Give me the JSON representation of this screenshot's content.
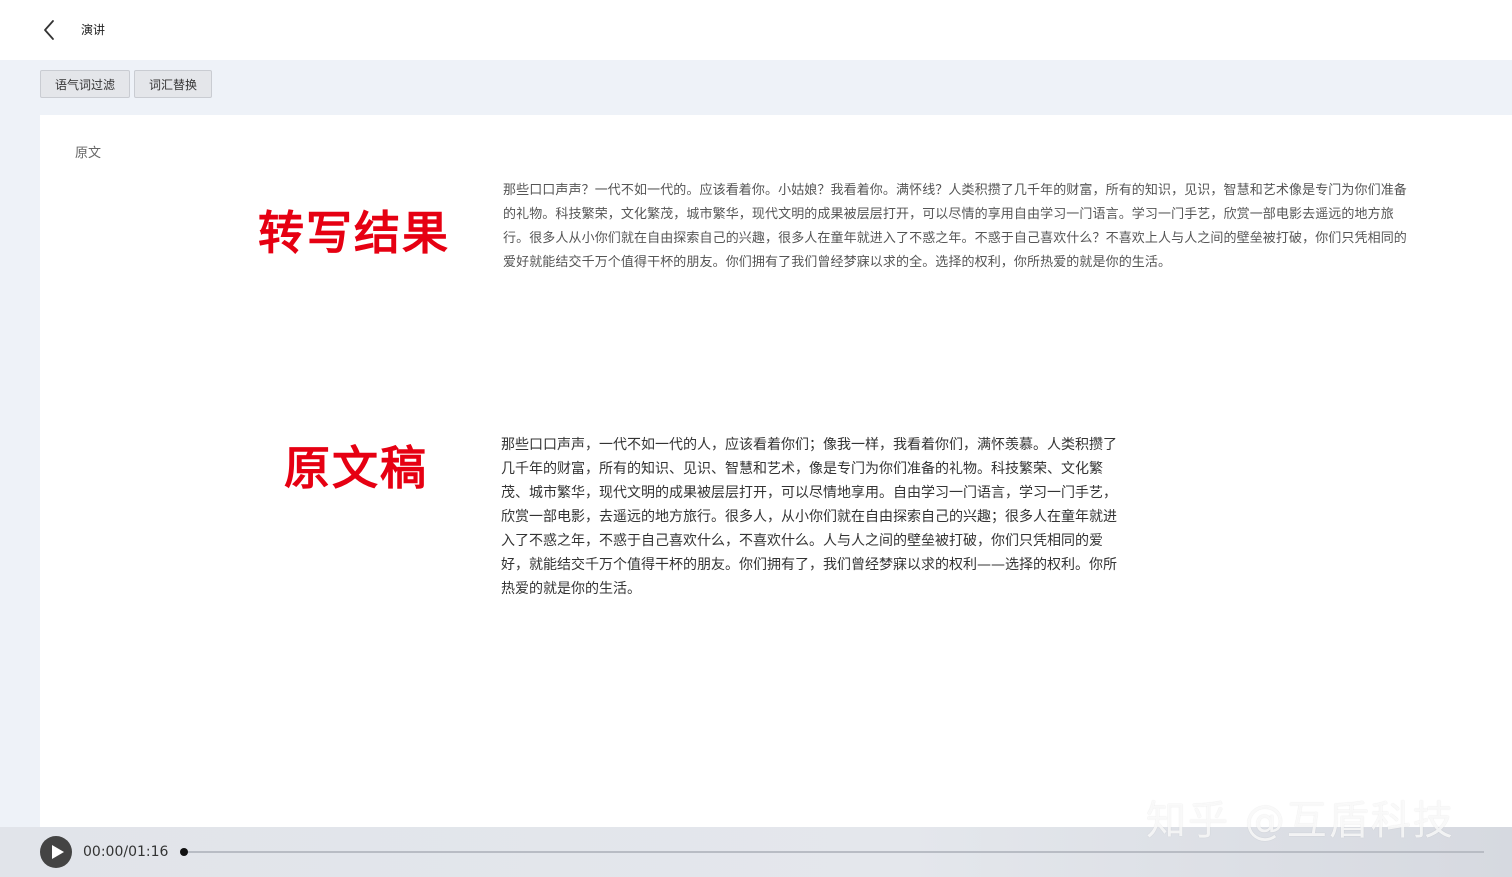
{
  "header": {
    "title": "演讲",
    "back_icon": "chevron-left-icon"
  },
  "toolbar": {
    "buttons": [
      {
        "label": "语气词过滤"
      },
      {
        "label": "词汇替换"
      }
    ]
  },
  "panel": {
    "section_label": "原文",
    "annotations": {
      "transcript": "转写结果",
      "original": "原文稿"
    },
    "transcript_text": "那些口口声声？一代不如一代的。应该看着你。小姑娘？我看着你。满怀线？人类积攒了几千年的财富，所有的知识，见识，智慧和艺术像是专门为你们准备的礼物。科技繁荣，文化繁茂，城市繁华，现代文明的成果被层层打开，可以尽情的享用自由学习一门语言。学习一门手艺，欣赏一部电影去遥远的地方旅行。很多人从小你们就在自由探索自己的兴趣，很多人在童年就进入了不惑之年。不惑于自己喜欢什么？不喜欢上人与人之间的壁垒被打破，你们只凭相同的爱好就能结交千万个值得干杯的朋友。你们拥有了我们曾经梦寐以求的全。选择的权利，你所热爱的就是你的生活。",
    "original_text": "那些口口声声，一代不如一代的人，应该看着你们；像我一样，我看着你们，满怀羡慕。人类积攒了几千年的财富，所有的知识、见识、智慧和艺术，像是专门为你们准备的礼物。科技繁荣、文化繁茂、城市繁华，现代文明的成果被层层打开，可以尽情地享用。自由学习一门语言，学习一门手艺，欣赏一部电影，去遥远的地方旅行。很多人，从小你们就在自由探索自己的兴趣；很多人在童年就进入了不惑之年，不惑于自己喜欢什么，不喜欢什么。人与人之间的壁垒被打破，你们只凭相同的爱好，就能结交千万个值得干杯的朋友。你们拥有了，我们曾经梦寐以求的权利——选择的权利。你所热爱的就是你的生活。"
  },
  "watermark": "知乎 @互盾科技",
  "player": {
    "time": "00:00/01:16",
    "progress": 0,
    "play_icon": "play-icon"
  },
  "colors": {
    "annotation": "#e60012",
    "background": "#eef2f8"
  }
}
